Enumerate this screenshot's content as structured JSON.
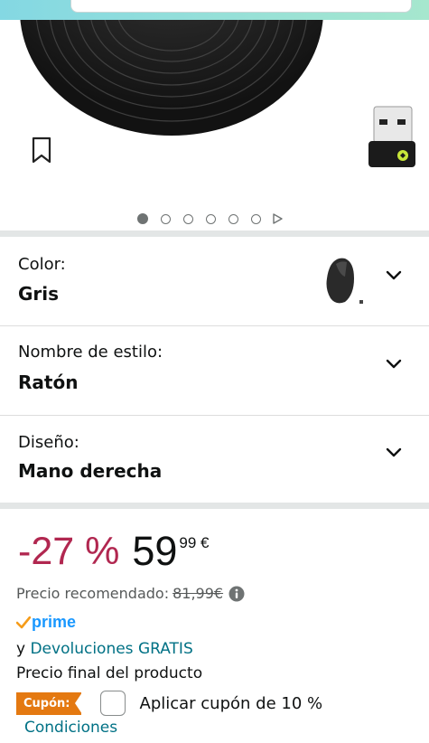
{
  "pagination": {
    "count": 6,
    "active_index": 0
  },
  "options": [
    {
      "label": "Color:",
      "value": "Gris"
    },
    {
      "label": "Nombre de estilo:",
      "value": "Ratón"
    },
    {
      "label": "Diseño:",
      "value": "Mano derecha"
    }
  ],
  "price": {
    "discount": "-27 %",
    "whole": "59",
    "fraction": "99 €",
    "recommended_label": "Precio recomendado:",
    "recommended_value": "81,99€"
  },
  "prime": {
    "label": "prime"
  },
  "returns": {
    "prefix": "y",
    "link": "Devoluciones GRATIS"
  },
  "final_price_text": "Precio final del producto",
  "coupon": {
    "badge": "Cupón:",
    "text": "Aplicar cupón de 10 %",
    "conditions": "Condiciones"
  },
  "colors": {
    "discount": "#b12750",
    "link": "#007185",
    "coupon_badge": "#e47911",
    "prime": "#1a98ff"
  }
}
